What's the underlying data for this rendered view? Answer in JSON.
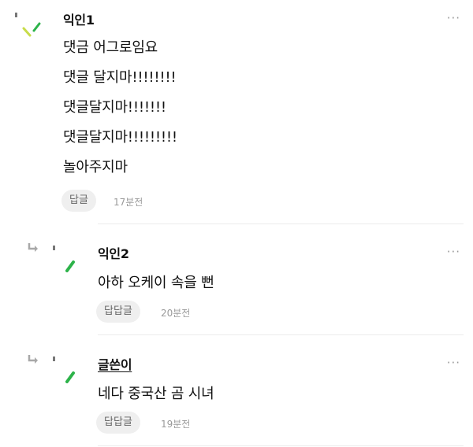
{
  "comments": [
    {
      "nickname": "익인1",
      "is_author": false,
      "more_label": "···",
      "lines": [
        "댓금 어그로임요",
        "댓글 달지마!!!!!!!!",
        "댓글달지마!!!!!!!",
        "댓글달지마!!!!!!!!!",
        "놀아주지마"
      ],
      "reply_label": "답글",
      "time": "17분전",
      "reply_arrow_icon": "reply-arrow-icon",
      "avatar_icon": "leaf-avatar-icon",
      "accent_colors": [
        "#c8dc4a",
        "#2db34a"
      ]
    },
    {
      "nickname": "익인2",
      "is_author": false,
      "more_label": "···",
      "lines": [
        "아하 오케이 속을 뻔"
      ],
      "reply_label": "답답글",
      "time": "20분전",
      "reply_arrow_icon": "reply-arrow-icon",
      "avatar_icon": "leaf-avatar-icon",
      "accent_colors": [
        "#2db34a"
      ]
    },
    {
      "nickname": "글쓴이",
      "is_author": true,
      "more_label": "···",
      "lines": [
        "네다 중국산 곰 시녀"
      ],
      "reply_label": "답답글",
      "time": "19분전",
      "reply_arrow_icon": "reply-arrow-icon",
      "avatar_icon": "leaf-avatar-icon",
      "accent_colors": [
        "#2db34a"
      ]
    }
  ]
}
